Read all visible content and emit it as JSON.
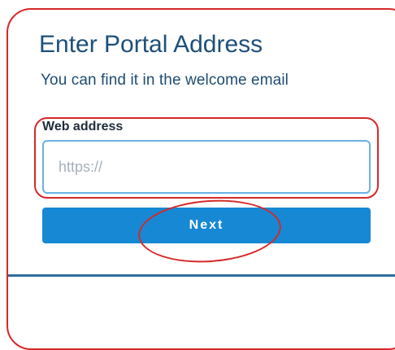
{
  "portal": {
    "title": "Enter Portal Address",
    "subtitle": "You can find it in the welcome email"
  },
  "form": {
    "web_address_label": "Web address",
    "web_address_value": "",
    "web_address_placeholder": "https://",
    "next_label": "Next"
  },
  "colors": {
    "accent": "#1788d4",
    "title": "#1e4f7a",
    "annotation": "#d62828"
  }
}
